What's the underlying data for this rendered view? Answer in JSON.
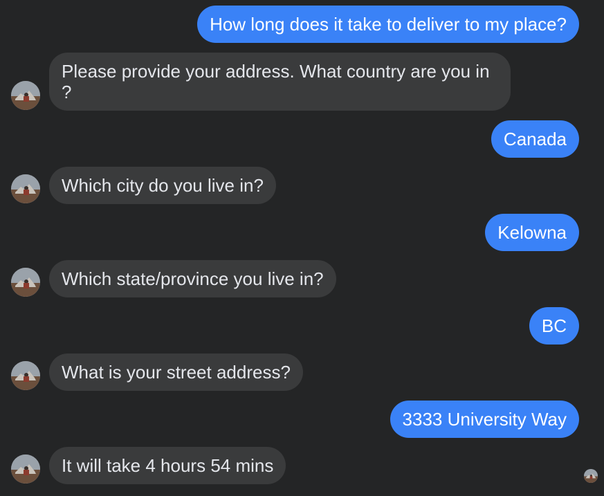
{
  "conversation": {
    "messages": [
      {
        "from": "user",
        "text": "How long does it take to deliver to my place?"
      },
      {
        "from": "bot",
        "text": "Please provide your address. What country are you in ?"
      },
      {
        "from": "user",
        "text": "Canada"
      },
      {
        "from": "bot",
        "text": "Which city do you live in?"
      },
      {
        "from": "user",
        "text": "Kelowna"
      },
      {
        "from": "bot",
        "text": "Which state/province you live in?"
      },
      {
        "from": "user",
        "text": "BC"
      },
      {
        "from": "bot",
        "text": "What is your street address?"
      },
      {
        "from": "user",
        "text": "3333 University Way"
      },
      {
        "from": "bot",
        "text": "It will take 4 hours 54 mins"
      }
    ]
  },
  "colors": {
    "background": "#242526",
    "outgoing_bubble": "#3a82f7",
    "incoming_bubble": "#3a3b3c",
    "incoming_text": "#e4e6eb",
    "outgoing_text": "#ffffff"
  },
  "icons": {
    "bot_avatar": "profile-photo-avatar",
    "seen_indicator": "read-receipt-avatar"
  }
}
